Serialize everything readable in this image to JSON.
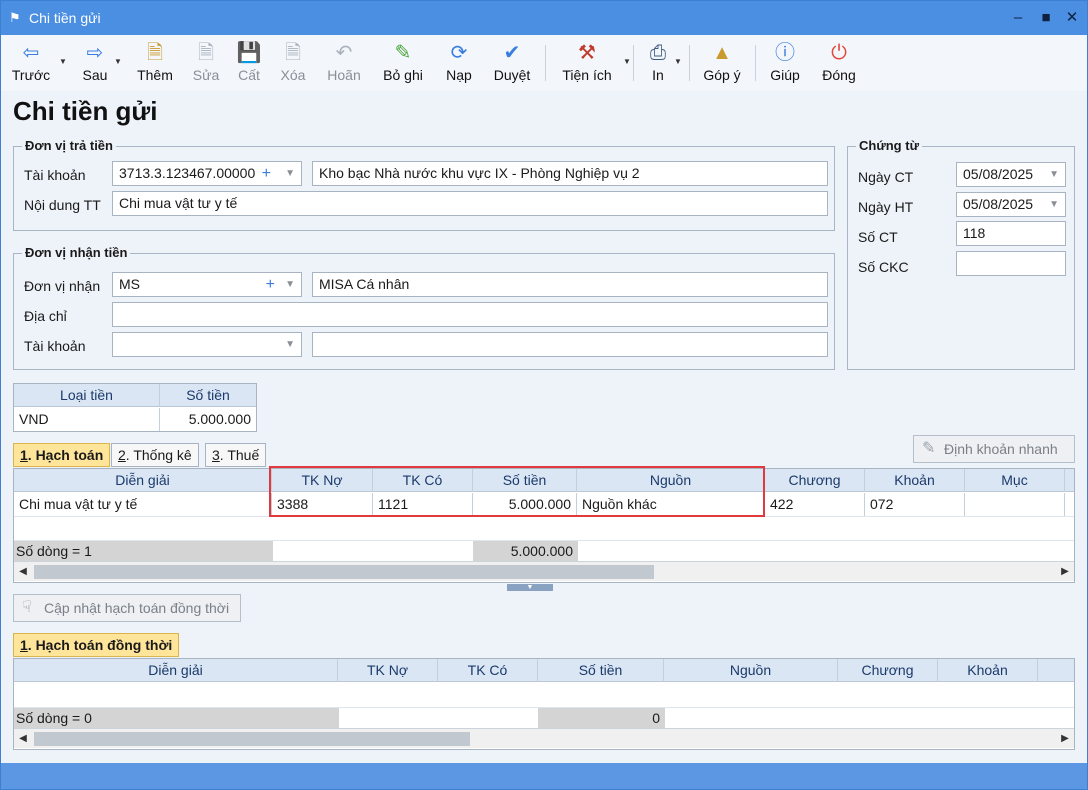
{
  "window": {
    "title": "Chi tiền gửi"
  },
  "toolbar": {
    "items": [
      {
        "label": "Trước",
        "icon": "arrow-left-icon",
        "enabled": true
      },
      {
        "label": "Sau",
        "icon": "arrow-right-icon",
        "enabled": true
      },
      {
        "label": "Thêm",
        "icon": "new-doc-icon",
        "enabled": true
      },
      {
        "label": "Sửa",
        "icon": "edit-doc-icon",
        "enabled": false
      },
      {
        "label": "Cất",
        "icon": "save-icon",
        "enabled": false
      },
      {
        "label": "Xóa",
        "icon": "delete-doc-icon",
        "enabled": false
      },
      {
        "label": "Hoãn",
        "icon": "undo-icon",
        "enabled": false
      },
      {
        "label": "Bỏ ghi",
        "icon": "unpost-icon",
        "enabled": true
      },
      {
        "label": "Nạp",
        "icon": "refresh-icon",
        "enabled": true
      },
      {
        "label": "Duyệt",
        "icon": "check-icon",
        "enabled": true
      },
      {
        "label": "Tiện ích",
        "icon": "tools-icon",
        "enabled": true
      },
      {
        "label": "In",
        "icon": "printer-icon",
        "enabled": true
      },
      {
        "label": "Góp ý",
        "icon": "feedback-icon",
        "enabled": true
      },
      {
        "label": "Giúp",
        "icon": "help-icon",
        "enabled": true
      },
      {
        "label": "Đóng",
        "icon": "power-icon",
        "enabled": true
      }
    ]
  },
  "page_title": "Chi tiền gửi",
  "payer": {
    "group_title": "Đơn vị trả tiền",
    "account_label": "Tài khoản",
    "account_value": "3713.3.123467.00000",
    "account_name": "Kho bạc Nhà nước khu vực IX - Phòng Nghiệp vụ 2",
    "content_label": "Nội dung TT",
    "content_value": "Chi mua vật tư y tế"
  },
  "payee": {
    "group_title": "Đơn vị nhận tiền",
    "unit_label": "Đơn vị nhận",
    "unit_value": "MS",
    "unit_name": "MISA Cá nhân",
    "address_label": "Địa chỉ",
    "address_value": "",
    "account_label": "Tài khoản",
    "account_value": "",
    "account_name": ""
  },
  "voucher": {
    "group_title": "Chứng từ",
    "date_ct_label": "Ngày CT",
    "date_ct_value": "05/08/2025",
    "date_ht_label": "Ngày HT",
    "date_ht_value": "05/08/2025",
    "so_ct_label": "Số CT",
    "so_ct_value": "118",
    "so_ckc_label": "Số CKC",
    "so_ckc_value": ""
  },
  "currency_grid": {
    "headers": [
      "Loại tiền",
      "Số tiền"
    ],
    "row": [
      "VND",
      "5.000.000"
    ]
  },
  "tabs_top": [
    {
      "num": "1",
      "rest": ". Hạch toán",
      "active": true
    },
    {
      "num": "2",
      "rest": ". Thống kê",
      "active": false
    },
    {
      "num": "3",
      "rest": ". Thuế",
      "active": false
    }
  ],
  "quick_entry_button": "Định khoản nhanh",
  "accounting_grid": {
    "headers": [
      "Diễn giải",
      "TK Nợ",
      "TK Có",
      "Số tiền",
      "Nguồn",
      "Chương",
      "Khoản",
      "Mục"
    ],
    "rows": [
      [
        "Chi mua vật tư y tế",
        "3388",
        "1121",
        "5.000.000",
        "Nguồn khác",
        "422",
        "072",
        ""
      ]
    ],
    "footer_count": "Số dòng = 1",
    "footer_total": "5.000.000"
  },
  "update_button": "Cập nhật hạch toán đồng thời",
  "tabs_bottom": [
    {
      "num": "1",
      "rest": ". Hạch toán đồng thời",
      "active": true
    }
  ],
  "concurrent_grid": {
    "headers": [
      "Diễn giải",
      "TK Nợ",
      "TK Có",
      "Số tiền",
      "Nguồn",
      "Chương",
      "Khoản"
    ],
    "footer_count": "Số dòng = 0",
    "footer_total": "0"
  }
}
